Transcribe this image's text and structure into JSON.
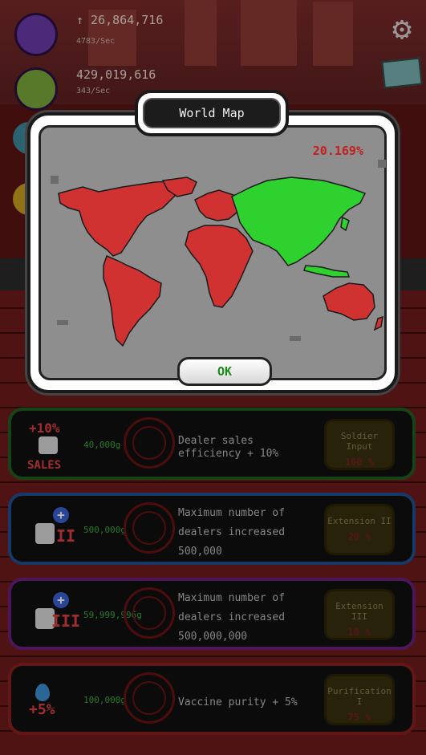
{
  "hud": {
    "vaccine_total": "↑ 26,864,716",
    "vaccine_rate": "4783/Sec",
    "gold_total": "429,019,616",
    "gold_rate": "343/Sec"
  },
  "modal": {
    "title": "World Map",
    "percent": "20.169%",
    "ok_label": "OK"
  },
  "map": {
    "infected_color": "#d03232",
    "cleared_color": "#2fd12f"
  },
  "upgrades": [
    {
      "badge": "+10%",
      "badge_sub": "SALES",
      "price": "40,000g",
      "desc_lines": [
        "Dealer sales",
        "efficiency + 10%"
      ],
      "action_title": "Soldier Input",
      "action_pct": "100 %",
      "border_color": "#1f5f1f"
    },
    {
      "badge": "II",
      "price": "500,000g",
      "desc_lines": [
        "Maximum number of",
        "dealers increased",
        "500,000"
      ],
      "action_title": "Extension II",
      "action_pct": "20 %",
      "border_color": "#1f4f8f"
    },
    {
      "badge": "III",
      "price": "59,999,996g",
      "desc_lines": [
        "Maximum number of",
        "dealers increased",
        "500,000,000"
      ],
      "action_title": "Extension III",
      "action_pct": "10 %",
      "border_color": "#6a1f7a"
    },
    {
      "badge": "+5%",
      "price": "100,000g",
      "desc_lines": [
        "Vaccine purity + 5%"
      ],
      "action_title": "Purification I",
      "action_pct": "75 %",
      "border_color": "#8a1f1f"
    }
  ]
}
